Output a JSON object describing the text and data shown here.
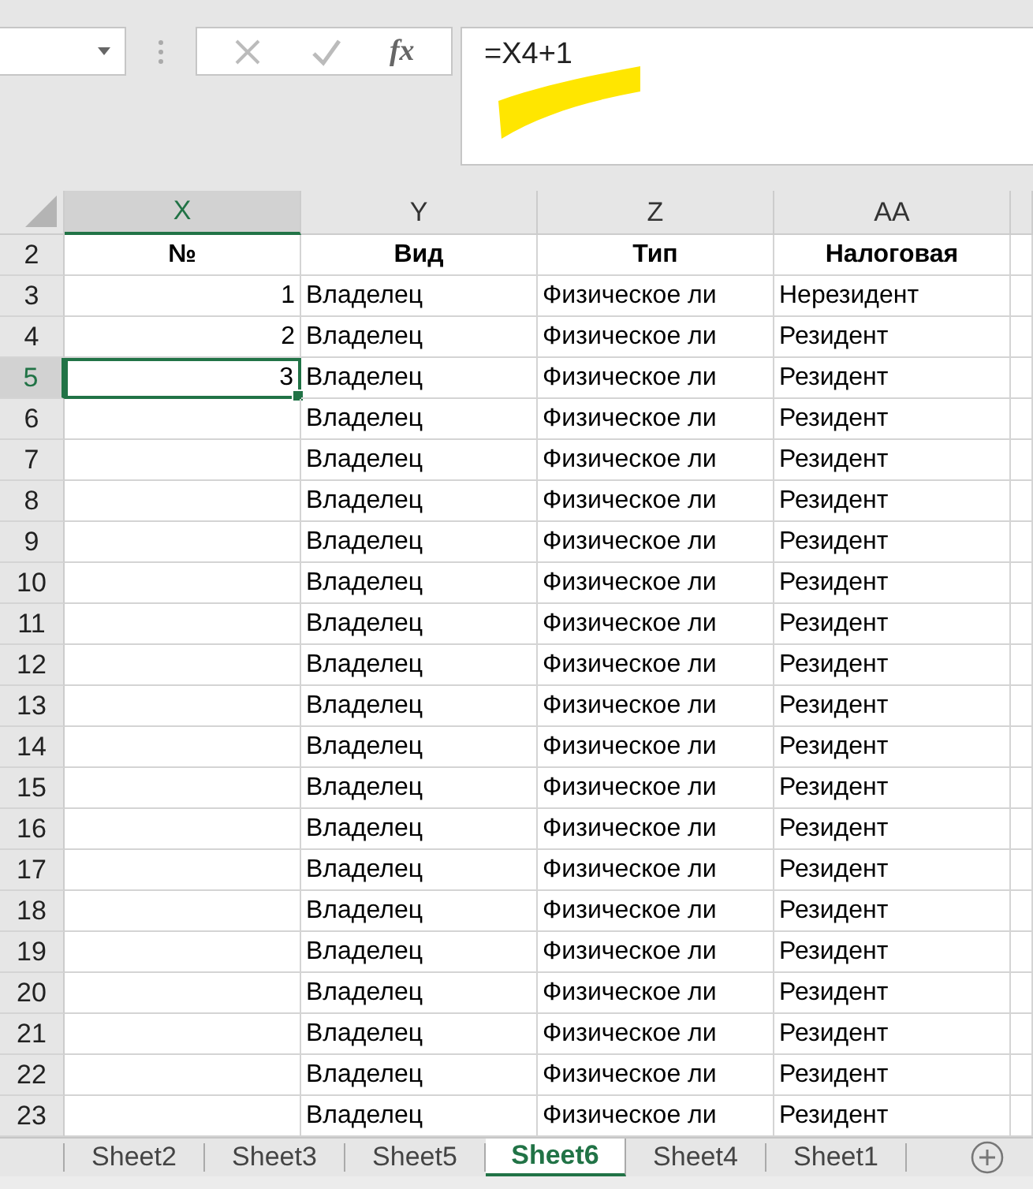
{
  "formula_bar": {
    "fx": "fx",
    "formula": "=X4+1"
  },
  "columns": [
    {
      "label": "X",
      "selected": true
    },
    {
      "label": "Y",
      "selected": false
    },
    {
      "label": "Z",
      "selected": false
    },
    {
      "label": "AA",
      "selected": false
    }
  ],
  "rows": [
    {
      "number": "2",
      "kind": "header",
      "selected": false,
      "no": "№",
      "vid": "Вид",
      "tip": "Тип",
      "tax": "Налоговая"
    },
    {
      "number": "3",
      "kind": "data",
      "selected": false,
      "no": "1",
      "vid": "Владелец",
      "tip": "Физическое ли",
      "tax": "Нерезидент"
    },
    {
      "number": "4",
      "kind": "data",
      "selected": false,
      "no": "2",
      "vid": "Владелец",
      "tip": "Физическое ли",
      "tax": "Резидент"
    },
    {
      "number": "5",
      "kind": "data",
      "selected": true,
      "no": "3",
      "vid": "Владелец",
      "tip": "Физическое ли",
      "tax": "Резидент"
    },
    {
      "number": "6",
      "kind": "data",
      "selected": false,
      "vid": "Владелец",
      "tip": "Физическое ли",
      "tax": "Резидент"
    },
    {
      "number": "7",
      "kind": "data",
      "selected": false,
      "vid": "Владелец",
      "tip": "Физическое ли",
      "tax": "Резидент"
    },
    {
      "number": "8",
      "kind": "data",
      "selected": false,
      "vid": "Владелец",
      "tip": "Физическое ли",
      "tax": "Резидент"
    },
    {
      "number": "9",
      "kind": "data",
      "selected": false,
      "vid": "Владелец",
      "tip": "Физическое ли",
      "tax": "Резидент"
    },
    {
      "number": "10",
      "kind": "data",
      "selected": false,
      "vid": "Владелец",
      "tip": "Физическое ли",
      "tax": "Резидент"
    },
    {
      "number": "11",
      "kind": "data",
      "selected": false,
      "vid": "Владелец",
      "tip": "Физическое ли",
      "tax": "Резидент"
    },
    {
      "number": "12",
      "kind": "data",
      "selected": false,
      "vid": "Владелец",
      "tip": "Физическое ли",
      "tax": "Резидент"
    },
    {
      "number": "13",
      "kind": "data",
      "selected": false,
      "vid": "Владелец",
      "tip": "Физическое ли",
      "tax": "Резидент"
    },
    {
      "number": "14",
      "kind": "data",
      "selected": false,
      "vid": "Владелец",
      "tip": "Физическое ли",
      "tax": "Резидент"
    },
    {
      "number": "15",
      "kind": "data",
      "selected": false,
      "vid": "Владелец",
      "tip": "Физическое ли",
      "tax": "Резидент"
    },
    {
      "number": "16",
      "kind": "data",
      "selected": false,
      "vid": "Владелец",
      "tip": "Физическое ли",
      "tax": "Резидент"
    },
    {
      "number": "17",
      "kind": "data",
      "selected": false,
      "vid": "Владелец",
      "tip": "Физическое ли",
      "tax": "Резидент"
    },
    {
      "number": "18",
      "kind": "data",
      "selected": false,
      "vid": "Владелец",
      "tip": "Физическое ли",
      "tax": "Резидент"
    },
    {
      "number": "19",
      "kind": "data",
      "selected": false,
      "vid": "Владелец",
      "tip": "Физическое ли",
      "tax": "Резидент"
    },
    {
      "number": "20",
      "kind": "data",
      "selected": false,
      "vid": "Владелец",
      "tip": "Физическое ли",
      "tax": "Резидент"
    },
    {
      "number": "21",
      "kind": "data",
      "selected": false,
      "vid": "Владелец",
      "tip": "Физическое ли",
      "tax": "Резидент"
    },
    {
      "number": "22",
      "kind": "data",
      "selected": false,
      "vid": "Владелец",
      "tip": "Физическое ли",
      "tax": "Резидент"
    },
    {
      "number": "23",
      "kind": "data",
      "selected": false,
      "vid": "Владелец",
      "tip": "Физическое ли",
      "tax": "Резидент"
    }
  ],
  "sheet_tabs": [
    {
      "label": "Sheet2",
      "selected": false
    },
    {
      "label": "Sheet3",
      "selected": false
    },
    {
      "label": "Sheet5",
      "selected": false
    },
    {
      "label": "Sheet6",
      "selected": true
    },
    {
      "label": "Sheet4",
      "selected": false
    },
    {
      "label": "Sheet1",
      "selected": false
    }
  ]
}
